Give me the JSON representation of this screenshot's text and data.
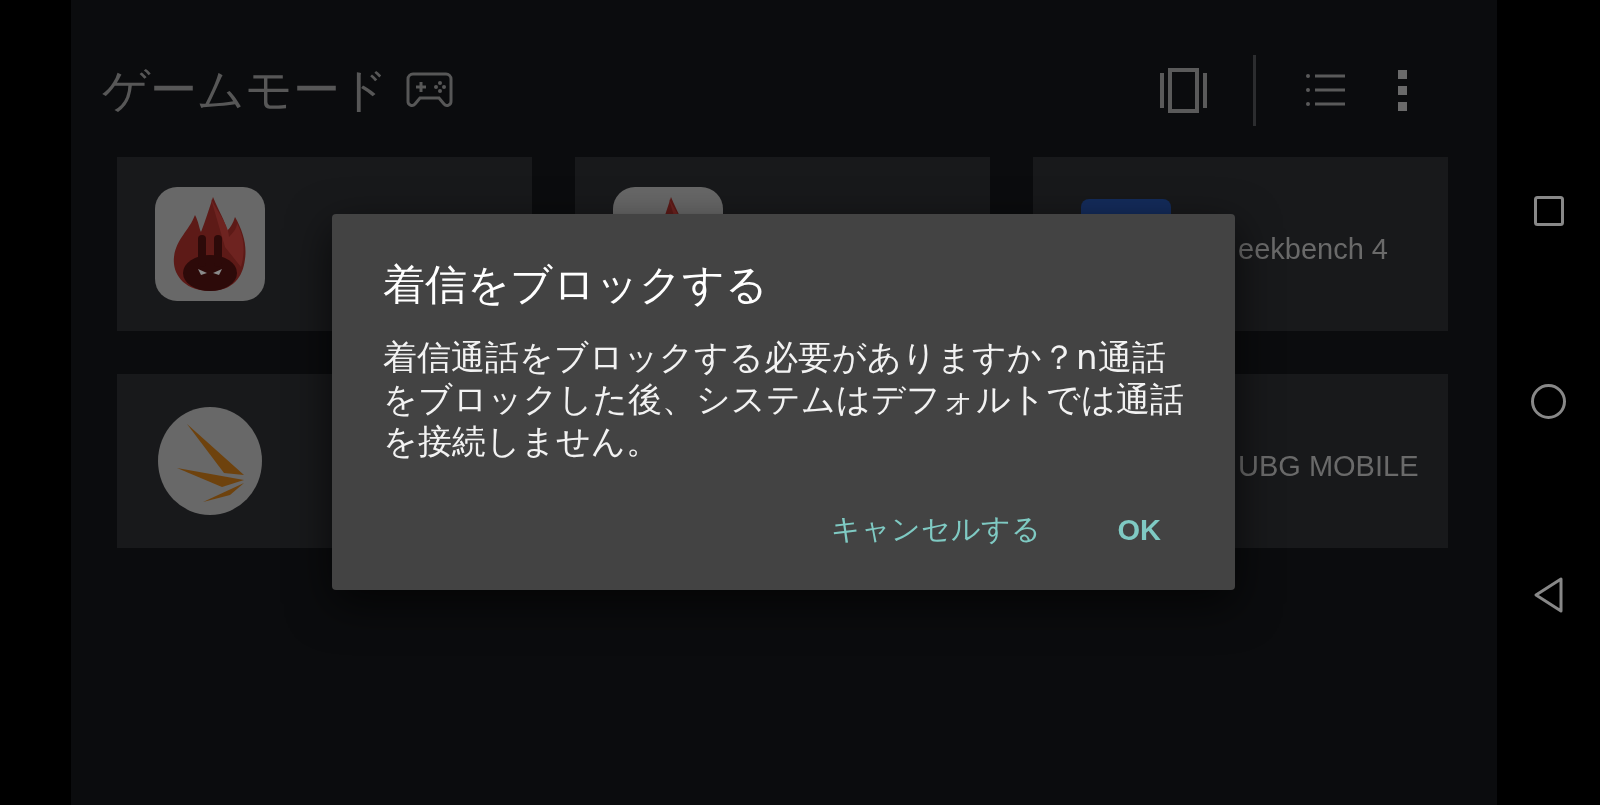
{
  "header": {
    "title": "ゲームモード"
  },
  "app_rows": [
    [
      {
        "kind": "flame"
      },
      {
        "kind": "flame"
      },
      {
        "kind": "tile",
        "name": "eekbench 4"
      }
    ],
    [
      {
        "kind": "arrows"
      },
      {
        "name": "UBG MOBILE"
      }
    ]
  ],
  "dialog": {
    "title": "着信をブロックする",
    "message": "着信通話をブロックする必要がありますか？n通話をブロックした後、システムはデフォルトでは通話を接続しません。",
    "buttons": [
      {
        "label": "キャンセルする",
        "kind": "cancel"
      },
      {
        "label": "OK",
        "kind": "confirm"
      }
    ]
  }
}
